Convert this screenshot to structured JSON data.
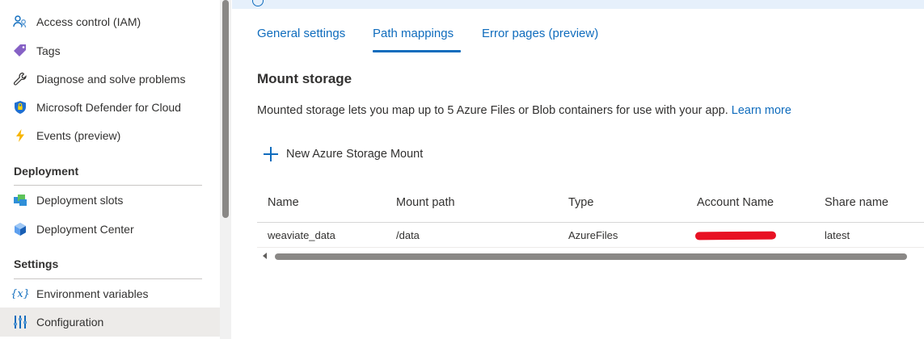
{
  "sidebar": {
    "items_top": [
      {
        "label": "Access control (IAM)",
        "icon": "people-icon"
      },
      {
        "label": "Tags",
        "icon": "tag-icon"
      },
      {
        "label": "Diagnose and solve problems",
        "icon": "wrench-icon"
      },
      {
        "label": "Microsoft Defender for Cloud",
        "icon": "shield-icon"
      },
      {
        "label": "Events (preview)",
        "icon": "lightning-icon"
      }
    ],
    "deployment_header": "Deployment",
    "deployment_items": [
      {
        "label": "Deployment slots",
        "icon": "slots-icon"
      },
      {
        "label": "Deployment Center",
        "icon": "cube-icon"
      }
    ],
    "settings_header": "Settings",
    "settings_items": [
      {
        "label": "Environment variables",
        "icon": "variable-icon",
        "glyph": "{x}"
      },
      {
        "label": "Configuration",
        "icon": "sliders-icon",
        "selected": true
      }
    ]
  },
  "tabs": [
    {
      "label": "General settings"
    },
    {
      "label": "Path mappings",
      "active": true
    },
    {
      "label": "Error pages (preview)"
    }
  ],
  "main": {
    "title": "Mount storage",
    "description": "Mounted storage lets you map up to 5 Azure Files or Blob containers for use with your app.",
    "learn_more": "Learn more",
    "new_mount_label": "New Azure Storage Mount"
  },
  "table": {
    "columns": [
      "Name",
      "Mount path",
      "Type",
      "Account Name",
      "Share name"
    ],
    "rows": [
      {
        "name": "weaviate_data",
        "mount_path": "/data",
        "type": "AzureFiles",
        "account_name": "",
        "share_name": "latest"
      }
    ]
  },
  "colors": {
    "accent": "#0f6cbd",
    "selected_bg": "#edebe9",
    "redaction": "#e81123"
  }
}
